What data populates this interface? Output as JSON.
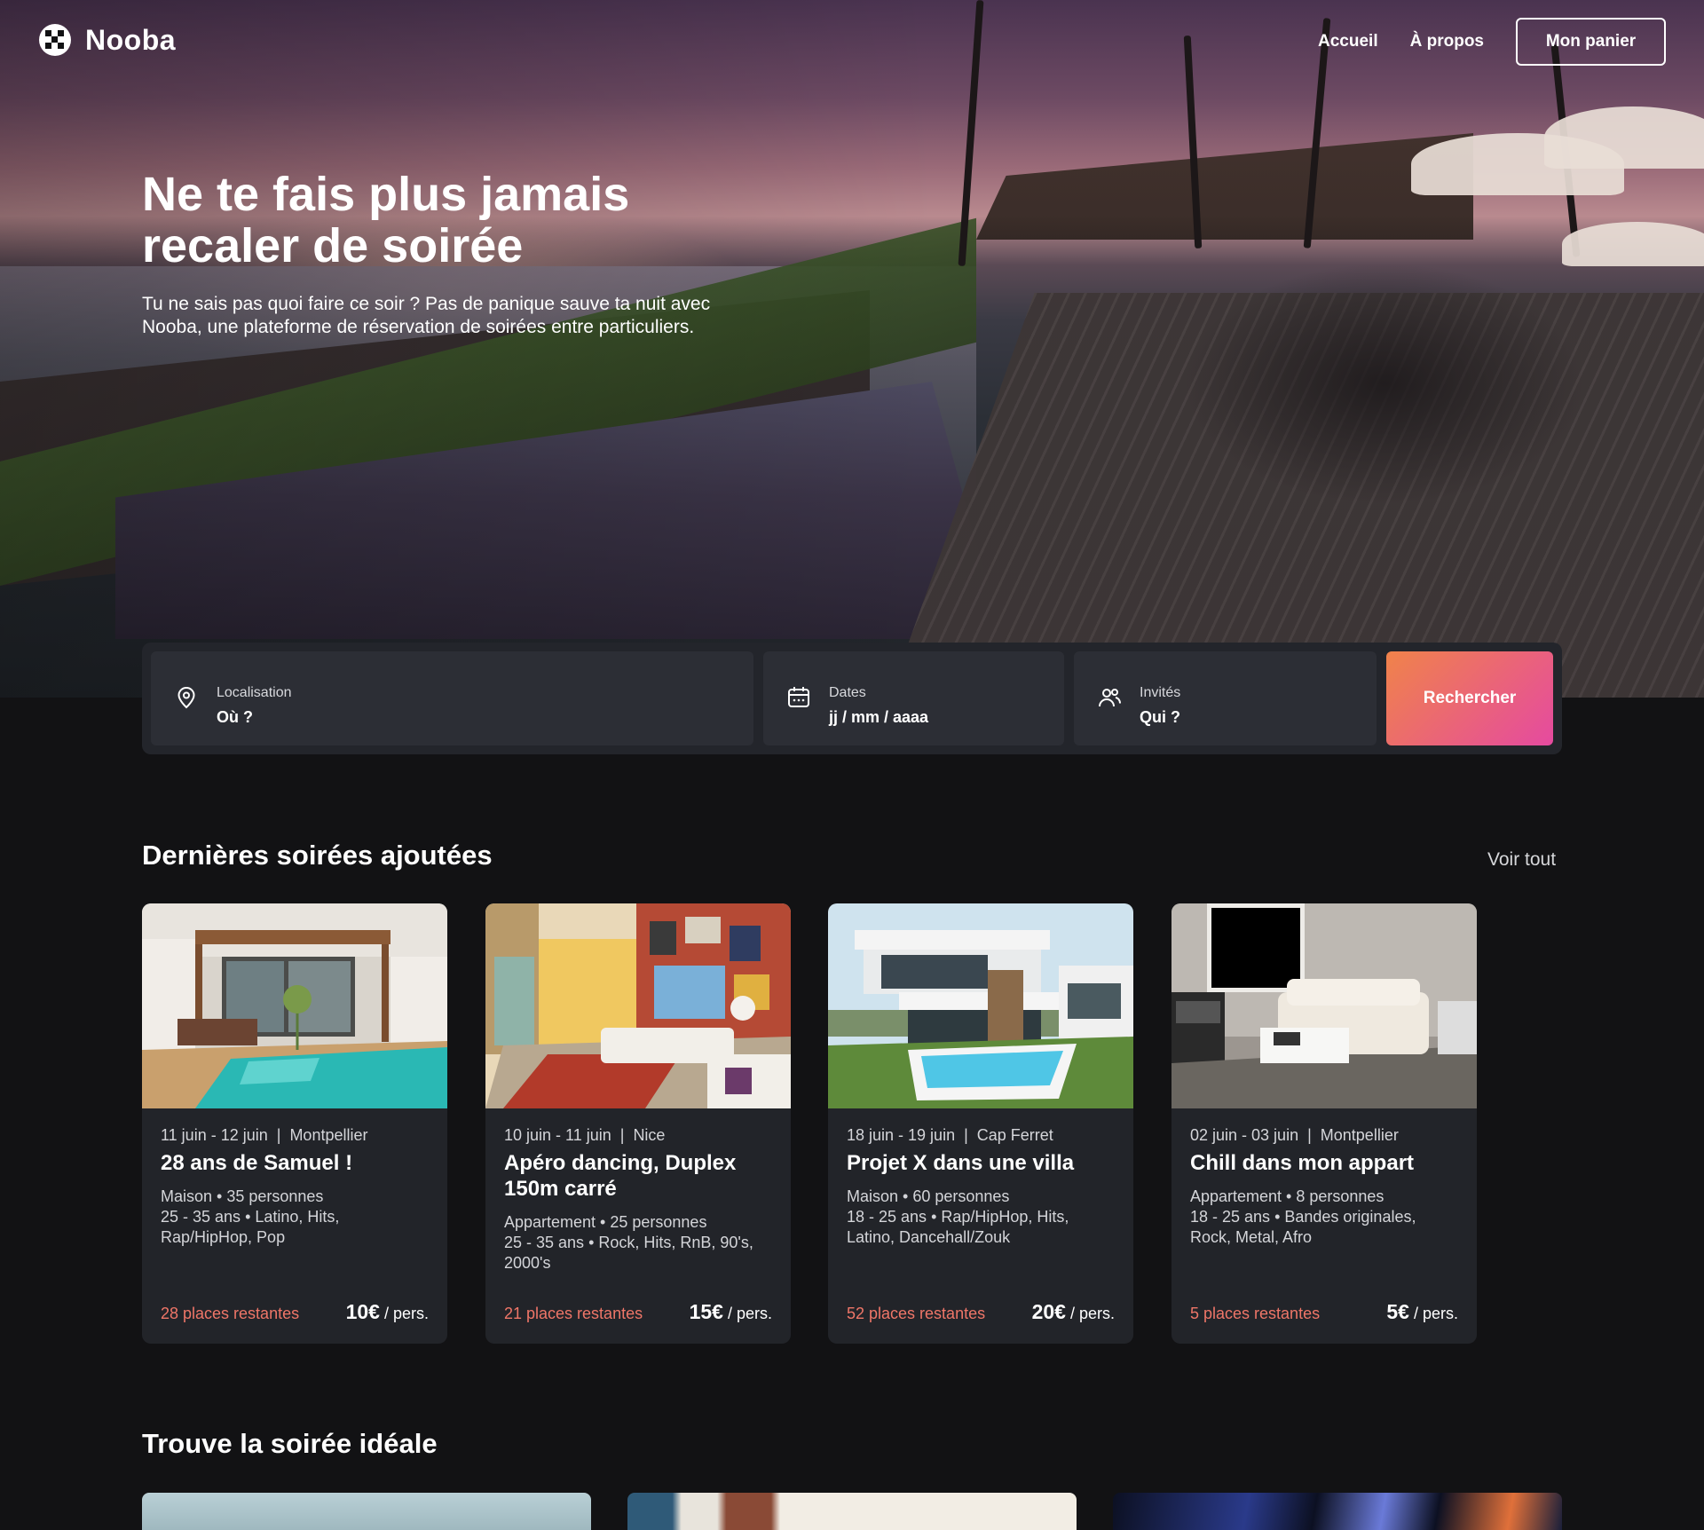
{
  "brand": {
    "name": "Nooba"
  },
  "nav": {
    "home": "Accueil",
    "about": "À propos",
    "cart": "Mon panier"
  },
  "hero": {
    "title_line1": "Ne te fais plus jamais",
    "title_line2": "recaler de soirée",
    "subtitle_line1": "Tu ne sais pas quoi faire ce soir ? Pas de panique sauve ta nuit avec",
    "subtitle_line2": "Nooba, une plateforme de réservation de soirées entre particuliers."
  },
  "search": {
    "location": {
      "label": "Localisation",
      "value": "Où ?",
      "icon": "location-pin-icon"
    },
    "dates": {
      "label": "Dates",
      "value": "jj / mm / aaaa",
      "icon": "calendar-icon"
    },
    "guests": {
      "label": "Invités",
      "value": "Qui ?",
      "icon": "users-icon"
    },
    "button": "Rechercher"
  },
  "latest": {
    "title": "Dernières soirées ajoutées",
    "see_all": "Voir tout",
    "cards": [
      {
        "dates": "11 juin - 12 juin",
        "city": "Montpellier",
        "title": "28 ans de Samuel !",
        "desc1": "Maison • 35 personnes",
        "desc2": "25 - 35 ans • Latino, Hits,",
        "desc3": "Rap/HipHop, Pop",
        "desc4": "",
        "places": "28 places restantes",
        "price": "10€",
        "per": " / pers."
      },
      {
        "dates": "10 juin - 11 juin",
        "city": "Nice",
        "title": "Apéro dancing, Duplex 150m carré",
        "desc1": "Appartement • 25 personnes",
        "desc2": "25 - 35 ans • Rock, Hits, RnB, 90's,",
        "desc3": "2000's",
        "desc4": "",
        "places": "21 places restantes",
        "price": "15€",
        "per": " / pers."
      },
      {
        "dates": "18 juin - 19 juin",
        "city": "Cap Ferret",
        "title": "Projet X dans une villa",
        "desc1": "Maison • 60 personnes",
        "desc2": "18 - 25 ans • Rap/HipHop, Hits,",
        "desc3": "Latino, Dancehall/Zouk",
        "desc4": "",
        "places": "52 places restantes",
        "price": "20€",
        "per": " / pers."
      },
      {
        "dates": "02 juin - 03 juin",
        "city": "Montpellier",
        "title": "Chill dans mon appart",
        "desc1": "Appartement • 8 personnes",
        "desc2": "18 - 25 ans • Bandes originales,",
        "desc3": "Rock, Metal, Afro",
        "desc4": "",
        "places": "5 places restantes",
        "price": "5€",
        "per": " / pers."
      }
    ]
  },
  "ideal": {
    "title": "Trouve la soirée idéale"
  },
  "colors": {
    "background": "#121214",
    "card": "#222429",
    "field": "#2c2e35",
    "accent_orange": "#f0834a",
    "accent_pink": "#e54aa0",
    "places": "#ef7668"
  }
}
